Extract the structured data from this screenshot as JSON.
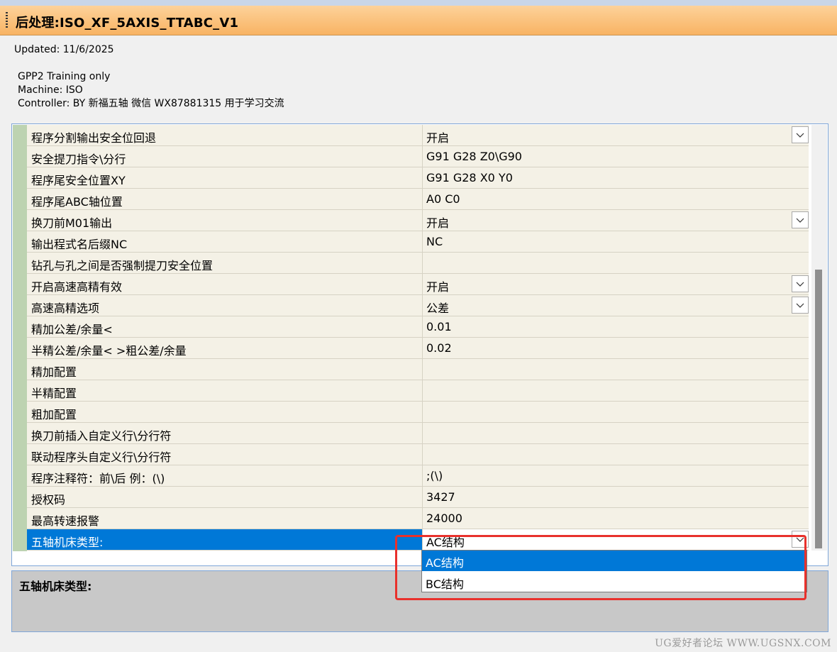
{
  "window": {
    "title": "后处理:ISO_XF_5AXIS_TTABC_V1"
  },
  "info": {
    "updated": "Updated: 11/6/2025",
    "line1": "GPP2 Training only",
    "line2": "Machine: ISO",
    "line3": "Controller: BY 新福五轴 微信 WX87881315 用于学习交流"
  },
  "rows": [
    {
      "label": "程序分割输出安全位回退",
      "value": "开启"
    },
    {
      "label": "安全提刀指令\\分行",
      "value": "G91 G28 Z0\\G90"
    },
    {
      "label": "程序尾安全位置XY",
      "value": "G91 G28 X0 Y0"
    },
    {
      "label": "程序尾ABC轴位置",
      "value": "A0 C0"
    },
    {
      "label": "换刀前M01输出",
      "value": "开启"
    },
    {
      "label": "输出程式名后缀NC",
      "value": "NC"
    },
    {
      "label": "钻孔与孔之间是否强制提刀安全位置",
      "value": ""
    },
    {
      "label": "开启高速高精有效",
      "value": "开启"
    },
    {
      "label": "高速高精选项",
      "value": "公差"
    },
    {
      "label": "精加公差/余量<",
      "value": "0.01"
    },
    {
      "label": "半精公差/余量< >粗公差/余量",
      "value": "0.02"
    },
    {
      "label": "精加配置",
      "value": ""
    },
    {
      "label": "半精配置",
      "value": ""
    },
    {
      "label": "粗加配置",
      "value": ""
    },
    {
      "label": "换刀前插入自定义行\\分行符",
      "value": ""
    },
    {
      "label": "联动程序头自定义行\\分行符",
      "value": ""
    },
    {
      "label": "程序注释符：前\\后 例：(\\)",
      "value": ";(\\)"
    },
    {
      "label": "授权码",
      "value": "3427"
    },
    {
      "label": "最高转速报警",
      "value": "24000"
    },
    {
      "label": "五轴机床类型:",
      "value": "AC结构"
    }
  ],
  "dropdown": {
    "options": [
      "AC结构",
      "BC结构"
    ],
    "highlighted": "AC结构"
  },
  "description": {
    "title": "五轴机床类型:"
  },
  "watermark": "UG爱好者论坛 WWW.UGSNX.COM",
  "colors": {
    "title_bar": "#f8b363",
    "selection": "#0078d7",
    "highlight_box": "#e8312c",
    "row_bg": "#f4f1e6",
    "left_strip": "#bdd3b1"
  }
}
